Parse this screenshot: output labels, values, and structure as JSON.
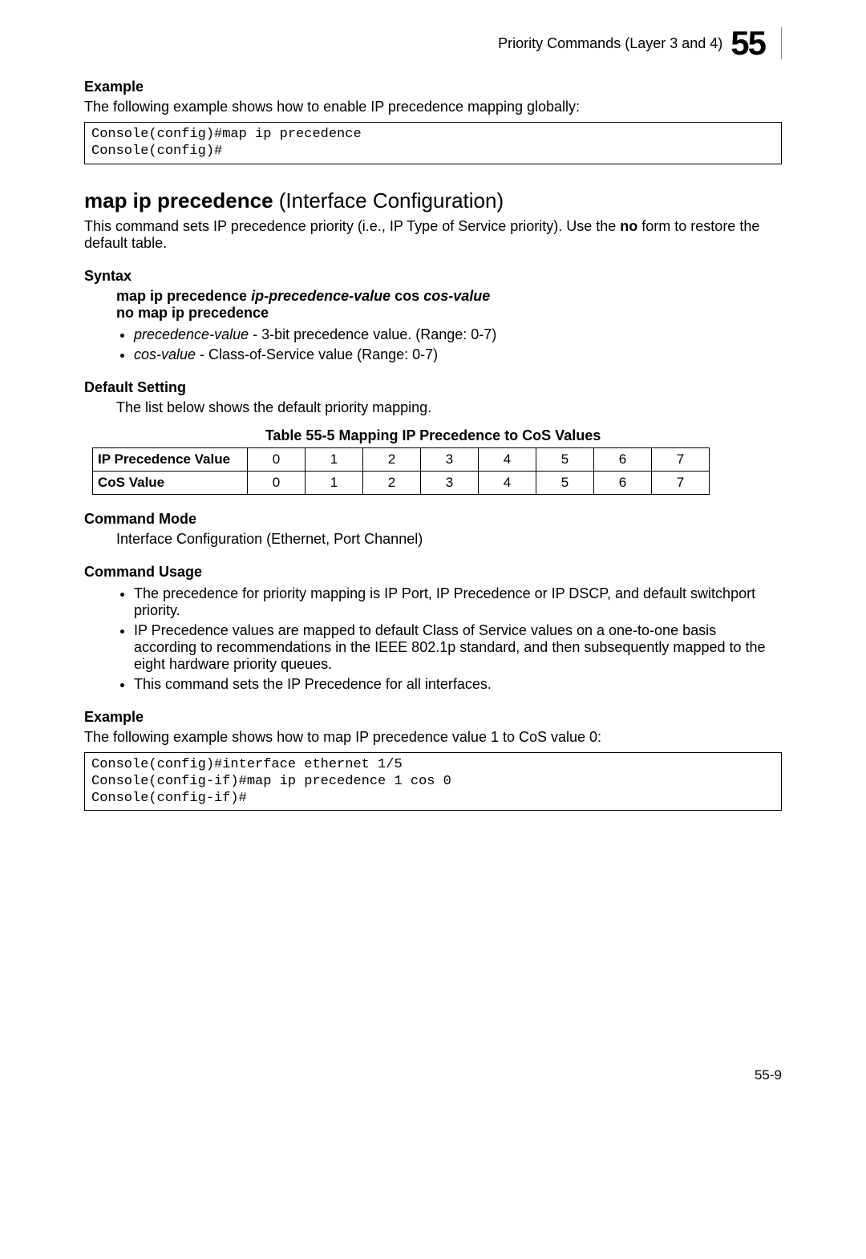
{
  "header": {
    "title": "Priority Commands (Layer 3 and 4)",
    "chapter_number": "55"
  },
  "example1": {
    "label": "Example",
    "intro": "The following example shows how to enable IP precedence mapping globally:",
    "code": "Console(config)#map ip precedence\nConsole(config)#"
  },
  "command": {
    "name_bold": "map ip precedence",
    "name_rest": " (Interface Configuration)",
    "desc_pre": "This command sets IP precedence priority (i.e., IP Type of Service priority). Use the ",
    "desc_bold": "no",
    "desc_post": " form to restore the default table."
  },
  "syntax": {
    "label": "Syntax",
    "line1_b1": "map ip precedence ",
    "line1_i1": "ip-precedence-value",
    "line1_b2": " cos ",
    "line1_i2": "cos-value",
    "line2": "no map ip precedence",
    "param1_name": "precedence-value",
    "param1_desc": " - 3-bit precedence value. (Range: 0-7)",
    "param2_name": "cos-value",
    "param2_desc": " - Class-of-Service value (Range: 0-7)"
  },
  "default_setting": {
    "label": "Default Setting",
    "text": "The list below shows the default priority mapping.",
    "table_caption": "Table 55-5   Mapping IP Precedence to CoS Values",
    "row1_label": "IP Precedence Value",
    "row2_label": "CoS Value"
  },
  "chart_data": {
    "type": "table",
    "title": "Mapping IP Precedence to CoS Values",
    "rows": [
      {
        "label": "IP Precedence Value",
        "values": [
          0,
          1,
          2,
          3,
          4,
          5,
          6,
          7
        ]
      },
      {
        "label": "CoS Value",
        "values": [
          0,
          1,
          2,
          3,
          4,
          5,
          6,
          7
        ]
      }
    ]
  },
  "command_mode": {
    "label": "Command Mode",
    "text": "Interface Configuration (Ethernet, Port Channel)"
  },
  "command_usage": {
    "label": "Command Usage",
    "items": [
      "The precedence for priority mapping is IP Port, IP Precedence or IP DSCP, and default switchport priority.",
      "IP Precedence values are mapped to default Class of Service values on a one-to-one basis according to recommendations in the IEEE 802.1p standard, and then subsequently mapped to the eight hardware priority queues.",
      "This command sets the IP Precedence for all interfaces."
    ]
  },
  "example2": {
    "label": "Example",
    "intro": "The following example shows how to map IP precedence value 1 to CoS value 0:",
    "code": "Console(config)#interface ethernet 1/5\nConsole(config-if)#map ip precedence 1 cos 0\nConsole(config-if)#"
  },
  "footer": {
    "page": "55-9"
  }
}
